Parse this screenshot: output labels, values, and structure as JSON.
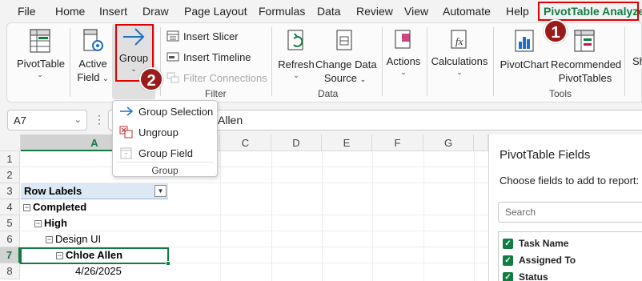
{
  "menu": {
    "tabs": [
      "File",
      "Home",
      "Insert",
      "Draw",
      "Page Layout",
      "Formulas",
      "Data",
      "Review",
      "View",
      "Automate",
      "Help",
      "PivotTable Analyze"
    ],
    "active_tab": "PivotTable Analyze"
  },
  "ribbon": {
    "pivottable": {
      "label": "PivotTable"
    },
    "active_field": {
      "line1": "Active",
      "line2": "Field"
    },
    "group": {
      "label": "Group"
    },
    "insert_slicer": "Insert Slicer",
    "insert_timeline": "Insert Timeline",
    "filter_connections": "Filter Connections",
    "filter_group_label": "Filter",
    "refresh": "Refresh",
    "change_data_source": {
      "line1": "Change Data",
      "line2": "Source"
    },
    "data_group_label": "Data",
    "actions": "Actions",
    "calculations": "Calculations",
    "pivotchart": "PivotChart",
    "recommended": {
      "line1": "Recommended",
      "line2": "PivotTables"
    },
    "tools_group_label": "Tools",
    "show_partial": "Sh"
  },
  "badges": {
    "one": "1",
    "two": "2"
  },
  "dropdown": {
    "items": [
      "Group Selection",
      "Ungroup",
      "Group Field"
    ],
    "group_label": "Group"
  },
  "formula_bar": {
    "name_box": "A7",
    "formula_value": "Allen"
  },
  "grid": {
    "columns": [
      "A",
      "B",
      "C",
      "D",
      "E",
      "F",
      "G"
    ],
    "rows": [
      "1",
      "2",
      "3",
      "4",
      "5",
      "6",
      "7",
      "8"
    ],
    "selected_column": "A",
    "selected_row": "7",
    "cells": {
      "row_labels": "Row Labels",
      "completed": "Completed",
      "high": "High",
      "design_ui": "Design UI",
      "chloe_allen": "Chloe Allen",
      "date": "4/26/2025"
    },
    "collapse_symbol": "⊟"
  },
  "pivot_pane": {
    "title": "PivotTable Fields",
    "subtitle": "Choose fields to add to report:",
    "search_placeholder": "Search",
    "fields": [
      "Task Name",
      "Assigned To",
      "Status"
    ]
  },
  "colors": {
    "accent_green": "#107c41",
    "highlight_red": "#e00000",
    "badge_red": "#9b1b1b",
    "pivot_header_blue": "#dde8f5"
  }
}
